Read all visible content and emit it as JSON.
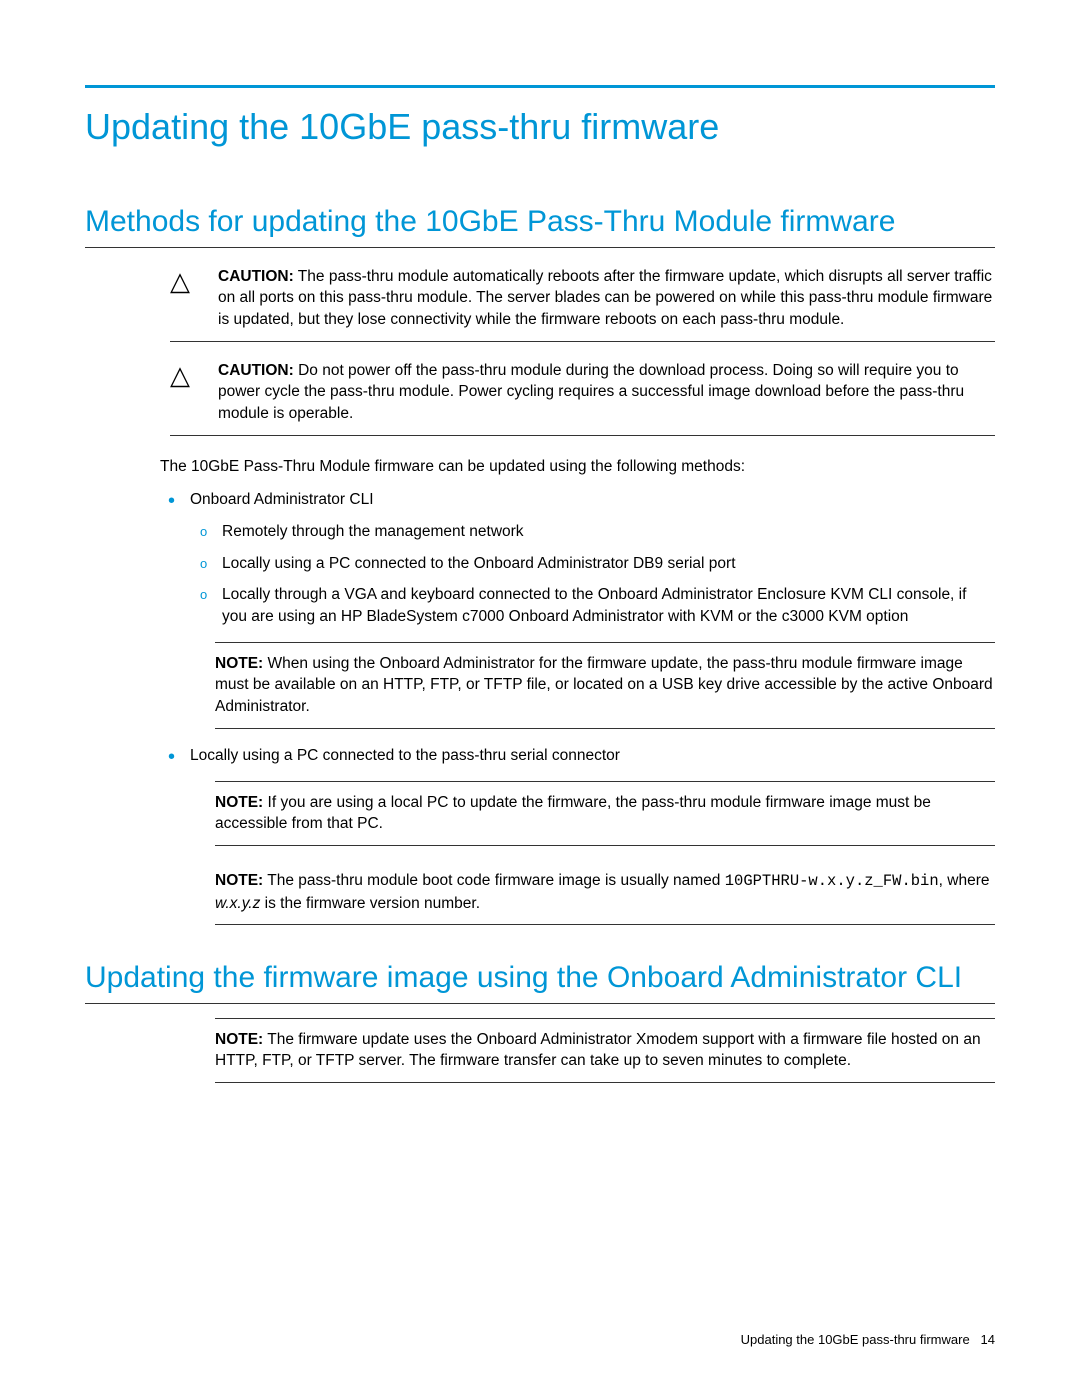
{
  "title": "Updating the 10GbE pass-thru firmware",
  "section1": {
    "heading": "Methods for updating the 10GbE Pass-Thru Module firmware",
    "caution1": {
      "label": "CAUTION:",
      "text": "  The pass-thru module automatically reboots after the firmware update, which disrupts all server traffic on all ports on this pass-thru module. The server blades can be powered on while this pass-thru module firmware is updated, but they lose connectivity while the firmware reboots on each pass-thru module."
    },
    "caution2": {
      "label": "CAUTION:",
      "text": "  Do not power off the pass-thru module during the download process. Doing so will require you to power cycle the pass-thru module. Power cycling requires a successful image download before the pass-thru module is operable."
    },
    "intro": "The 10GbE Pass-Thru Module firmware can be updated using the following methods:",
    "item1": "Onboard Administrator CLI",
    "sub1": "Remotely through the management network",
    "sub2": "Locally using a PC connected to the Onboard Administrator DB9 serial port",
    "sub3": "Locally through a VGA and keyboard connected to the Onboard Administrator Enclosure KVM CLI console, if you are using an HP BladeSystem c7000 Onboard Administrator with KVM or the c3000 KVM option",
    "note1": {
      "label": "NOTE:",
      "text": "  When using the Onboard Administrator for the firmware update, the pass-thru module firmware image must be available on an HTTP, FTP, or TFTP file, or located on a USB key drive accessible by the active Onboard Administrator."
    },
    "item2": "Locally using a PC connected to the pass-thru serial connector",
    "note2": {
      "label": "NOTE:",
      "text": "  If you are using a local PC to update the firmware, the pass-thru module firmware image must be accessible from that PC."
    },
    "note3": {
      "label": "NOTE:",
      "pre": "  The pass-thru module boot code firmware image is usually named ",
      "code": "10GPTHRU-w.x.y.z_FW.bin",
      "mid": ", where ",
      "var": "w.x.y.z",
      "post": " is the firmware version number."
    }
  },
  "section2": {
    "heading": "Updating the firmware image using the Onboard Administrator CLI",
    "note": {
      "label": "NOTE:",
      "text": "  The firmware update uses the Onboard Administrator Xmodem support with a firmware file hosted on an HTTP, FTP, or TFTP server. The firmware transfer can take up to seven minutes to complete."
    }
  },
  "footer": {
    "text": "Updating the 10GbE pass-thru firmware",
    "page": "14"
  }
}
